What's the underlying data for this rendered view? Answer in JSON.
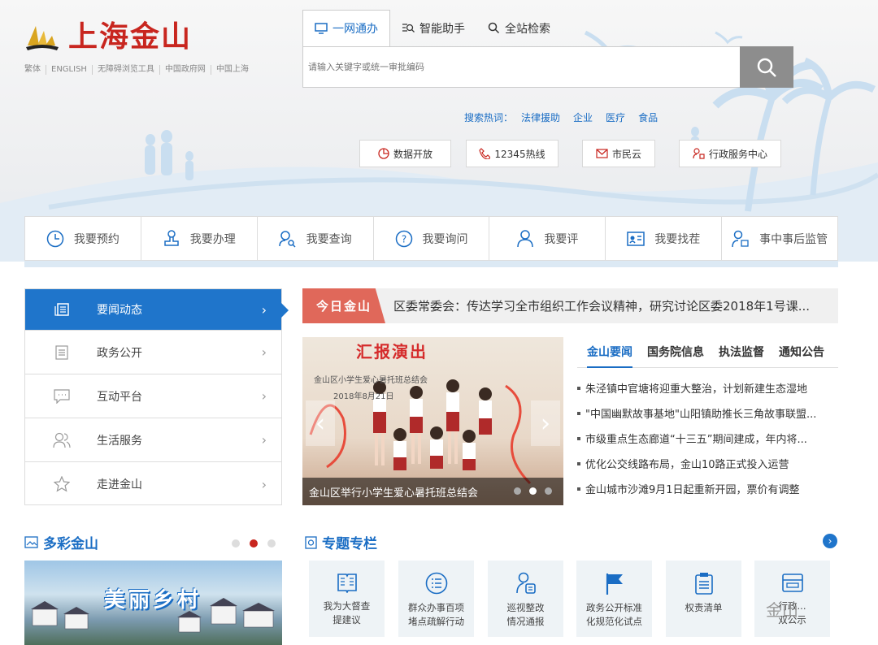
{
  "header": {
    "site_name": "上海金山",
    "top_links": [
      "繁体",
      "ENGLISH",
      "无障碍浏览工具",
      "中国政府网",
      "中国上海"
    ]
  },
  "search": {
    "tabs": [
      {
        "label": "一网通办",
        "icon": "monitor-icon"
      },
      {
        "label": "智能助手",
        "icon": "robot-search-icon"
      },
      {
        "label": "全站检索",
        "icon": "search-icon"
      }
    ],
    "placeholder": "请输入关键字或统一审批编码",
    "hot_label": "搜索热词：",
    "hot_words": [
      "法律援助",
      "企业",
      "医疗",
      "食品"
    ]
  },
  "quick_links": [
    {
      "label": "数据开放",
      "icon": "pie-chart-icon"
    },
    {
      "label": "12345热线",
      "icon": "phone-icon"
    },
    {
      "label": "市民云",
      "icon": "mail-icon"
    },
    {
      "label": "行政服务中心",
      "icon": "service-center-icon"
    }
  ],
  "services": [
    {
      "label": "我要预约",
      "icon": "clock-icon"
    },
    {
      "label": "我要办理",
      "icon": "stamp-icon"
    },
    {
      "label": "我要查询",
      "icon": "user-search-icon"
    },
    {
      "label": "我要询问",
      "icon": "question-icon"
    },
    {
      "label": "我要评",
      "icon": "person-icon"
    },
    {
      "label": "我要找茬",
      "icon": "id-card-icon"
    },
    {
      "label": "事中事后监管",
      "icon": "supervise-icon"
    }
  ],
  "sidebar": {
    "items": [
      {
        "label": "要闻动态",
        "icon": "news-icon",
        "active": true
      },
      {
        "label": "政务公开",
        "icon": "document-icon"
      },
      {
        "label": "互动平台",
        "icon": "chat-icon"
      },
      {
        "label": "生活服务",
        "icon": "people-icon"
      },
      {
        "label": "走进金山",
        "icon": "star-icon"
      }
    ]
  },
  "ticker": {
    "badge": "今日金山",
    "text": "区委常委会：传达学习全市组织工作会议精神，研究讨论区委2018年1号课..."
  },
  "slide": {
    "headline": "汇报演出",
    "sub": "金山区小学生爱心暑托班总结会",
    "date": "2018年8月21日",
    "caption": "金山区举行小学生爱心暑托班总结会"
  },
  "news": {
    "tabs": [
      "金山要闻",
      "国务院信息",
      "执法监督",
      "通知公告"
    ],
    "items": [
      "朱泾镇中官塘将迎重大整治，计划新建生态湿地",
      "\"中国幽默故事基地\"山阳镇助推长三角故事联盟...",
      "市级重点生态廊道“十三五”期间建成，年内将...",
      "优化公交线路布局，金山10路正式投入运营",
      "金山城市沙滩9月1日起重新开园，票价有调整"
    ]
  },
  "colorful": {
    "title": "多彩金山",
    "photo_text": "美丽乡村"
  },
  "topics": {
    "title": "专题专栏",
    "items": [
      {
        "label": "我为大督查\n提建议",
        "icon": "book-icon"
      },
      {
        "label": "群众办事百项\n堵点疏解行动",
        "icon": "list-icon"
      },
      {
        "label": "巡视整改\n情况通报",
        "icon": "inspect-icon"
      },
      {
        "label": "政务公开标准\n化规范化试点",
        "icon": "flag-icon"
      },
      {
        "label": "权责清单",
        "icon": "clipboard-icon"
      },
      {
        "label": "行政...\n双公示",
        "icon": "wallet-icon"
      }
    ]
  },
  "watermark": "金山",
  "colors": {
    "brand_red": "#c8261f",
    "accent_blue": "#1f75cb",
    "ticker_red": "#e0685a"
  }
}
